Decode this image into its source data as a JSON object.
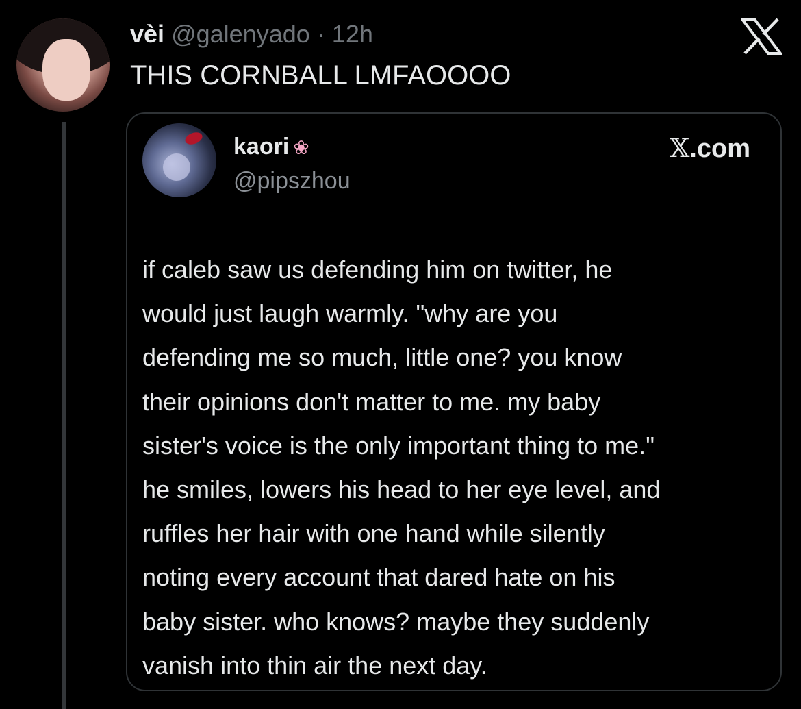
{
  "tweet": {
    "author_name": "vèi",
    "author_handle": "@galenyado",
    "separator": "·",
    "time": "12h",
    "text": "THIS CORNBALL LMFAOOOO"
  },
  "quoted_tweet": {
    "author_name": "kaori",
    "author_emoji": "lotus-icon",
    "author_handle": "@pipszhou",
    "site_label": ".com",
    "site_mark": "𝕏",
    "lines": [
      "if caleb saw us defending him on twitter, he",
      "would just laugh warmly. \"why are you",
      "defending me so much, little one? you know",
      "their opinions don't matter to me. my baby",
      "sister's voice is the only important thing to me.\"",
      "he smiles, lowers his head to her eye level, and",
      "ruffles her hair with one hand while silently",
      "noting every account that dared hate on his",
      "baby sister. who knows? maybe they suddenly",
      "vanish into thin air the next day."
    ]
  },
  "colors": {
    "background": "#000000",
    "text_primary": "#e7e9ea",
    "text_secondary": "#71767b",
    "border": "#2f3336"
  }
}
